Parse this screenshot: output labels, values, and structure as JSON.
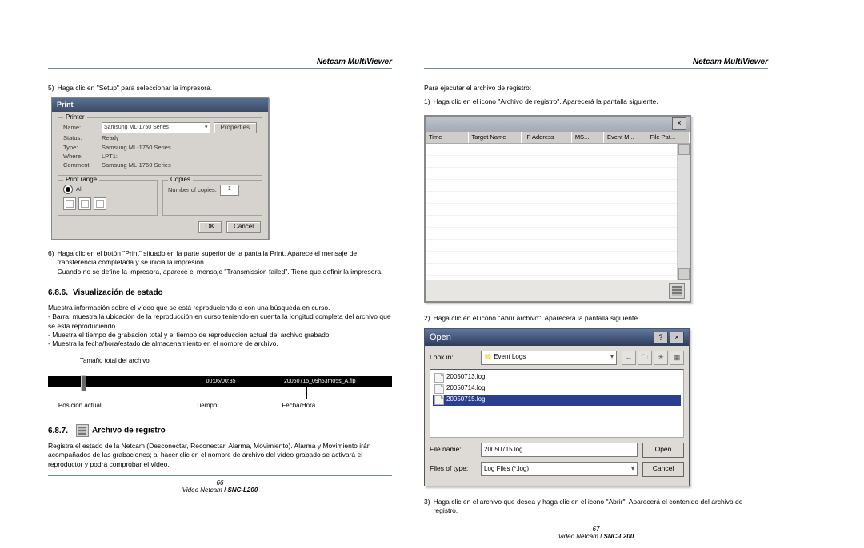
{
  "left": {
    "header": "Netcam MultiViewer",
    "step5": "Haga clic en \"Setup\" para seleccionar la impresora.",
    "step5_num": "5)",
    "print_dialog": {
      "title": "Print",
      "grp_printer": "Printer",
      "lbl_name": "Name:",
      "val_name": "Samsung ML-1750 Series",
      "btn_prop": "Properties",
      "lbl_status": "Status:",
      "val_status": "Ready",
      "lbl_type": "Type:",
      "val_type": "Samsung ML-1750 Series",
      "lbl_where": "Where:",
      "val_where": "LPT1:",
      "lbl_comment": "Comment:",
      "val_comment": "Samsung ML-1750 Series",
      "grp_range": "Print range",
      "opt_all": "All",
      "grp_copies": "Copies",
      "lbl_copies": "Number of copies:",
      "val_copies": "1",
      "btn_ok": "OK",
      "btn_cancel": "Cancel"
    },
    "step6_num": "6)",
    "step6a": "Haga clic en el botón \"Print\" situado en la parte superior de la pantalla Print. Aparece el mensaje de transferencia completada y se inicia la impresión.",
    "step6b": "Cuando no se define la impresora, aparece el mensaje \"Transmission failed\". Tiene que definir la impresora.",
    "sec686_num": "6.8.6.",
    "sec686_title": "Visualización de estado",
    "sec686_intro": "Muestra información sobre el vídeo que se está reproduciendo o con una búsqueda en curso.",
    "sec686_b1": "- Barra: muestra la ubicación de la reproducción en curso teniendo en cuenta la longitud completa del archivo que se está reproduciendo.",
    "sec686_b2": "- Muestra el tiempo de grabación total y el tiempo de reproducción actual del archivo grabado.",
    "sec686_b3": "- Muestra la fecha/hora/estado de almacenamiento en el nombre de archivo.",
    "status": {
      "top_label": "Tamaño total del archivo",
      "time_box": "00:06/00:35",
      "file_box": "20050715_09h53m05s_A.flp",
      "l1": "Posición actual",
      "l2": "Tiempo",
      "l3": "Fecha/Hora"
    },
    "sec687_num": "6.8.7.",
    "sec687_title": "Archivo de registro",
    "sec687_body": "Registra el estado de la Netcam (Desconectar, Reconectar, Alarma, Movimiento). Alarma y Movimiento irán acompañados de las grabaciones; al hacer clic en el nombre de archivo del vídeo grabado se activará el reproductor y podrá comprobar el vídeo.",
    "page_num": "66",
    "product": "Video Netcam I",
    "model": "SNC-L200"
  },
  "right": {
    "header": "Netcam MultiViewer",
    "intro": "Para ejecutar el archivo de registro:",
    "step1_num": "1)",
    "step1": "Haga clic en el icono \"Archivo de registro\". Aparecerá la pantalla siguiente.",
    "log_cols": {
      "c1": "Time",
      "c2": "Target Name",
      "c3": "IP Address",
      "c4": "MS...",
      "c5": "Event M...",
      "c6": "File Pat..."
    },
    "step2_num": "2)",
    "step2": "Haga clic en el icono \"Abrir archivo\". Aparecerá la pantalla siguiente.",
    "open": {
      "title": "Open",
      "lookin_lbl": "Look in:",
      "lookin_val": "Event Logs",
      "file1": "20050713.log",
      "file2": "20050714.log",
      "file3": "20050715.log",
      "fname_lbl": "File name:",
      "fname_val": "20050715.log",
      "ftype_lbl": "Files of type:",
      "ftype_val": "Log Files (*.log)",
      "btn_open": "Open",
      "btn_cancel": "Cancel"
    },
    "step3_num": "3)",
    "step3": "Haga clic en el archivo que desea y haga clic en el icono \"Abrir\". Aparecerá el contenido del archivo de registro.",
    "page_num": "67",
    "product": "Video Netcam I",
    "model": "SNC-L200"
  }
}
